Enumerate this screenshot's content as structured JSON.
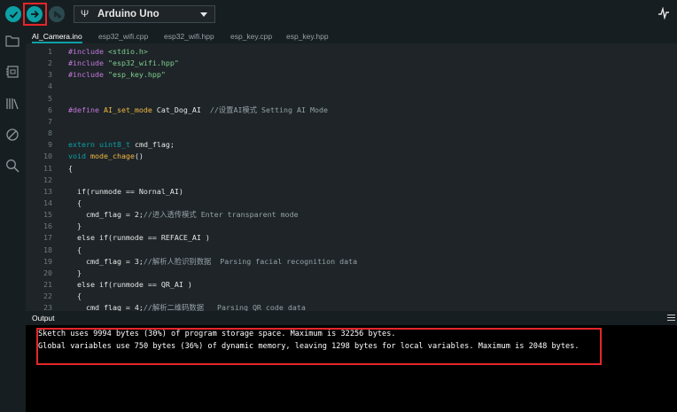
{
  "toolbar": {
    "board_name": "Arduino Uno",
    "usb_symbol": "Ψ",
    "icons": [
      "verify-icon",
      "upload-icon",
      "debug-icon",
      "serial-plotter-icon"
    ]
  },
  "sidebar": {
    "icons": [
      "folder-icon",
      "boards-manager-icon",
      "library-icon",
      "debug-icon",
      "search-icon"
    ]
  },
  "tabs": [
    "AI_Camera.ino",
    "esp32_wifi.cpp",
    "esp32_wifi.hpp",
    "esp_key.cpp",
    "esp_key.hpp"
  ],
  "editor": {
    "line_numbers": [
      "1",
      "2",
      "3",
      "4",
      "5",
      "6",
      "7",
      "8",
      "9",
      "10",
      "11",
      "12",
      "13",
      "14",
      "15",
      "16",
      "17",
      "18",
      "19",
      "20",
      "21",
      "22",
      "23"
    ],
    "lines": [
      "#include <stdio.h>",
      "#include \"esp32_wifi.hpp\"",
      "#include \"esp_key.hpp\"",
      "",
      "",
      "#define AI_set_mode Cat_Dog_AI  //设置AI模式 Setting AI Mode",
      "",
      "",
      "extern uint8_t cmd_flag;",
      "void mode_chage()",
      "{",
      "",
      "  if(runmode == Nornal_AI)",
      "  {",
      "    cmd_flag = 2;//进入透传模式 Enter transparent mode",
      "  }",
      "  else if(runmode == REFACE_AI )",
      "  {",
      "    cmd_flag = 3;//解析人脸识别数据  Parsing facial recognition data",
      "  }",
      "  else if(runmode == QR_AI )",
      "  {",
      "    cmd_flag = 4;//解析二维码数据   Parsing QR code data"
    ]
  },
  "output": {
    "title": "Output",
    "lines": [
      "Sketch uses 9994 bytes (30%) of program storage space. Maximum is 32256 bytes.",
      "Global variables use 750 bytes (36%) of dynamic memory, leaving 1298 bytes for local variables. Maximum is 2048 bytes."
    ]
  },
  "colors": {
    "accent": "#0ca1a6",
    "highlight_box": "#e5262a",
    "background": "#1e2428"
  }
}
